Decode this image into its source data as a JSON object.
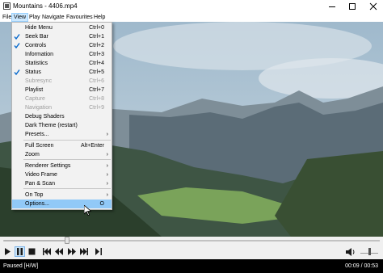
{
  "window": {
    "title": "Mountains - 4406.mp4",
    "app_icon": "film-icon"
  },
  "menubar": {
    "items": [
      "File",
      "View",
      "Play",
      "Navigate",
      "Favourites",
      "Help"
    ],
    "active": "View"
  },
  "view_menu": {
    "items": [
      {
        "label": "Hide Menu",
        "shortcut": "Ctrl+0",
        "checked": false,
        "enabled": true,
        "submenu": false
      },
      {
        "label": "Seek Bar",
        "shortcut": "Ctrl+1",
        "checked": true,
        "enabled": true,
        "submenu": false
      },
      {
        "label": "Controls",
        "shortcut": "Ctrl+2",
        "checked": true,
        "enabled": true,
        "submenu": false
      },
      {
        "label": "Information",
        "shortcut": "Ctrl+3",
        "checked": false,
        "enabled": true,
        "submenu": false
      },
      {
        "label": "Statistics",
        "shortcut": "Ctrl+4",
        "checked": false,
        "enabled": true,
        "submenu": false
      },
      {
        "label": "Status",
        "shortcut": "Ctrl+5",
        "checked": true,
        "enabled": true,
        "submenu": false
      },
      {
        "label": "Subresync",
        "shortcut": "Ctrl+6",
        "checked": false,
        "enabled": false,
        "submenu": false
      },
      {
        "label": "Playlist",
        "shortcut": "Ctrl+7",
        "checked": false,
        "enabled": true,
        "submenu": false
      },
      {
        "label": "Capture",
        "shortcut": "Ctrl+8",
        "checked": false,
        "enabled": false,
        "submenu": false
      },
      {
        "label": "Navigation",
        "shortcut": "Ctrl+9",
        "checked": false,
        "enabled": false,
        "submenu": false
      },
      {
        "label": "Debug Shaders",
        "shortcut": "",
        "checked": false,
        "enabled": true,
        "submenu": false
      },
      {
        "label": "Dark Theme (restart)",
        "shortcut": "",
        "checked": false,
        "enabled": true,
        "submenu": false
      },
      {
        "label": "Presets...",
        "shortcut": "",
        "checked": false,
        "enabled": true,
        "submenu": true
      },
      {
        "label": "Full Screen",
        "shortcut": "Alt+Enter",
        "checked": false,
        "enabled": true,
        "submenu": false
      },
      {
        "label": "Zoom",
        "shortcut": "",
        "checked": false,
        "enabled": true,
        "submenu": true
      },
      {
        "label": "Renderer Settings",
        "shortcut": "",
        "checked": false,
        "enabled": true,
        "submenu": true
      },
      {
        "label": "Video Frame",
        "shortcut": "",
        "checked": false,
        "enabled": true,
        "submenu": true
      },
      {
        "label": "Pan & Scan",
        "shortcut": "",
        "checked": false,
        "enabled": true,
        "submenu": true
      },
      {
        "label": "On Top",
        "shortcut": "",
        "checked": false,
        "enabled": true,
        "submenu": true
      },
      {
        "label": "Options...",
        "shortcut": "O",
        "checked": false,
        "enabled": true,
        "submenu": false,
        "highlighted": true
      }
    ]
  },
  "seekbar": {
    "position_fraction": 0.17
  },
  "controls": {
    "buttons": [
      {
        "name": "play-button",
        "icon": "play-icon"
      },
      {
        "name": "pause-button",
        "icon": "pause-icon",
        "pressed": true
      },
      {
        "name": "stop-button",
        "icon": "stop-icon"
      },
      {
        "name": "previous-button",
        "icon": "skip-back-icon"
      },
      {
        "name": "rewind-button",
        "icon": "rewind-icon"
      },
      {
        "name": "fast-forward-button",
        "icon": "fast-forward-icon"
      },
      {
        "name": "next-button",
        "icon": "skip-forward-icon"
      },
      {
        "name": "frame-step-button",
        "icon": "frame-step-icon"
      }
    ],
    "volume_fraction": 0.5
  },
  "status": {
    "state": "Paused [H/W]",
    "time": "00:09 / 00:53"
  },
  "colors": {
    "menu_highlight": "#91c9f7",
    "active_menu": "#cce8ff",
    "check_blue": "#0066cc",
    "status_bg": "#000000"
  }
}
